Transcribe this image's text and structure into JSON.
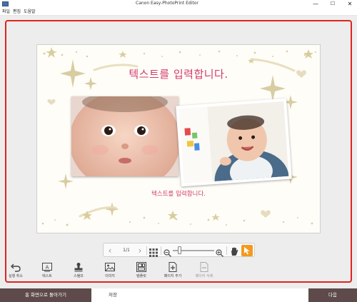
{
  "window": {
    "title": "Canon Easy-PhotoPrint Editor",
    "minimize": "—",
    "maximize": "☐",
    "close": "✕"
  },
  "menu": {
    "items": [
      "파일",
      "편집",
      "도움말"
    ]
  },
  "canvas": {
    "title_text": "텍스트를 입력합니다.",
    "subtitle_text": "텍스트를 입력합니다.",
    "accent_color": "#d23a6a"
  },
  "nav": {
    "page_indicator": "1/1",
    "prev": "‹",
    "next": "›",
    "zoom_out": "−",
    "zoom_in": "+"
  },
  "tools": {
    "undo": "실행 취소",
    "text": "텍스트",
    "stamp": "스탬프",
    "image": "이미지",
    "template": "템플릿",
    "add_page": "페이지 추가",
    "delete_page": "페이지 삭제"
  },
  "footer": {
    "back_label": "홈 화면으로 돌아가기",
    "save_label": "저장",
    "next_label": "다음"
  }
}
